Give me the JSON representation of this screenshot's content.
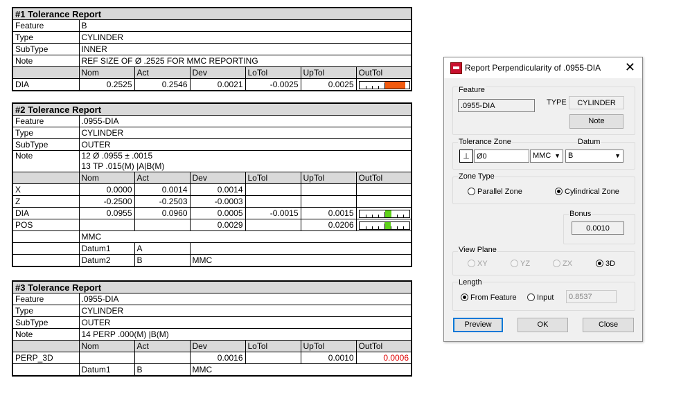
{
  "r1": {
    "title": "#1  Tolerance Report",
    "rows": [
      {
        "k": "Feature",
        "v": "B"
      },
      {
        "k": "Type",
        "v": "CYLINDER"
      },
      {
        "k": "SubType",
        "v": "INNER"
      },
      {
        "k": "Note",
        "v": "REF SIZE OF Ø .2525 FOR MMC REPORTING"
      }
    ],
    "headers": [
      "Nom",
      "Act",
      "Dev",
      "LoTol",
      "UpTol",
      "OutTol"
    ],
    "data": [
      {
        "name": "DIA",
        "nom": "0.2525",
        "act": "0.2546",
        "dev": "0.0021",
        "lotol": "-0.0025",
        "uptol": "0.0025",
        "gauge_fraction": 0.92,
        "gauge_color": "#f25a0f"
      }
    ]
  },
  "r2": {
    "title": "#2  Tolerance Report",
    "rows": [
      {
        "k": "Feature",
        "v": ".0955-DIA"
      },
      {
        "k": "Type",
        "v": "CYLINDER"
      },
      {
        "k": "SubType",
        "v": "OUTER"
      }
    ],
    "note_label": "Note",
    "note_lines": [
      "12  Ø .0955 ± .0015",
      "13  TP .015(M) |A|B(M)"
    ],
    "headers": [
      "Nom",
      "Act",
      "Dev",
      "LoTol",
      "UpTol",
      "OutTol"
    ],
    "data": [
      {
        "name": "X",
        "nom": "0.0000",
        "act": "0.0014",
        "dev": "0.0014",
        "lotol": "",
        "uptol": ""
      },
      {
        "name": "Z",
        "nom": "-0.2500",
        "act": "-0.2503",
        "dev": "-0.0003",
        "lotol": "",
        "uptol": ""
      },
      {
        "name": "DIA",
        "nom": "0.0955",
        "act": "0.0960",
        "dev": "0.0005",
        "lotol": "-0.0015",
        "uptol": "0.0015",
        "gauge_fraction": 0.58,
        "gauge_color": "#5fd31a"
      },
      {
        "name": "POS",
        "nom": "",
        "act": "",
        "dev": "0.0029",
        "lotol": "",
        "uptol": "0.0206",
        "gauge_fraction": 0.57,
        "gauge_color": "#5fd31a"
      }
    ],
    "mmc": "MMC",
    "datums": [
      {
        "name": "Datum1",
        "ref": "A",
        "mod": ""
      },
      {
        "name": "Datum2",
        "ref": "B",
        "mod": "MMC"
      }
    ]
  },
  "r3": {
    "title": "#3  Tolerance Report",
    "rows": [
      {
        "k": "Feature",
        "v": ".0955-DIA"
      },
      {
        "k": "Type",
        "v": "CYLINDER"
      },
      {
        "k": "SubType",
        "v": "OUTER"
      },
      {
        "k": "Note",
        "v": "14  PERP .000(M) |B(M)"
      }
    ],
    "headers": [
      "Nom",
      "Act",
      "Dev",
      "LoTol",
      "UpTol",
      "OutTol"
    ],
    "data": [
      {
        "name": "PERP_3D",
        "dev": "0.0016",
        "uptol": "0.0010",
        "outtol": "0.0006"
      }
    ],
    "datum": {
      "name": "Datum1",
      "ref": "B",
      "mod": "MMC"
    },
    "out_color": "#e00000"
  },
  "dialog": {
    "title": "Report Perpendicularity of .0955-DIA",
    "feature_label": "Feature",
    "feature_value": ".0955-DIA",
    "type_label": "TYPE",
    "type_value": "CYLINDER",
    "note_button": "Note",
    "tol_zone_label": "Tolerance Zone",
    "perp_symbol": "⊥",
    "tol_value": "Ø0",
    "modifier": "MMC",
    "datum_label": "Datum",
    "datum_value": "B",
    "zone_type_label": "Zone Type",
    "zone_parallel": "Parallel Zone",
    "zone_cyl": "Cylindrical Zone",
    "bonus_label": "Bonus",
    "bonus_value": "0.0010",
    "view_plane_label": "View Plane",
    "vp_xy": "XY",
    "vp_yz": "YZ",
    "vp_zx": "ZX",
    "vp_3d": "3D",
    "length_label": "Length",
    "len_from_feature": "From Feature",
    "len_input": "Input",
    "len_value": "0.8537",
    "preview": "Preview",
    "ok": "OK",
    "close": "Close"
  }
}
